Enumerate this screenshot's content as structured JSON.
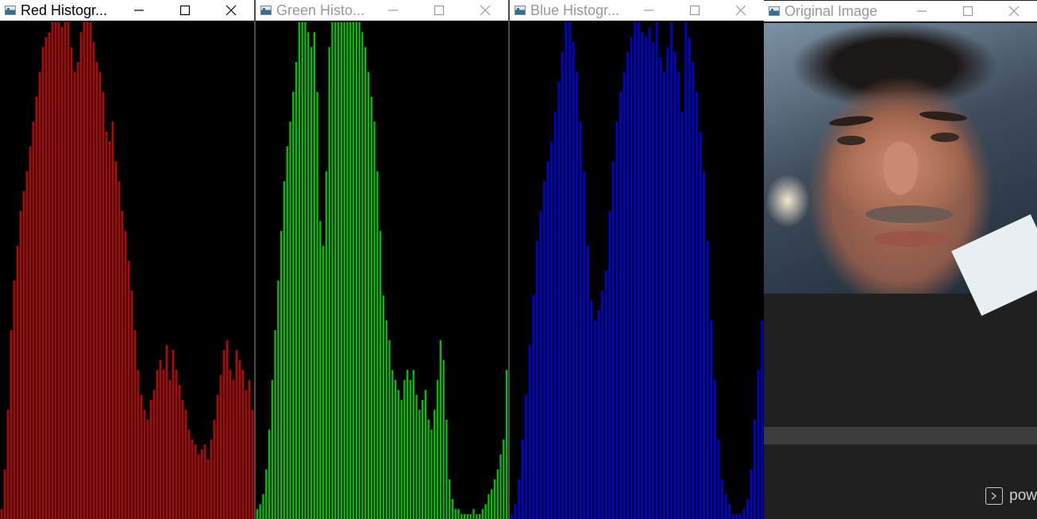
{
  "windows": {
    "red": {
      "title": "Red Histogr...",
      "bar_color": "#c00000"
    },
    "green": {
      "title": "Green Histo...",
      "bar_color": "#00c000"
    },
    "blue": {
      "title": "Blue Histogr...",
      "bar_color": "#0000cc"
    },
    "original": {
      "title": "Original Image"
    }
  },
  "terminal": {
    "label": "pow"
  },
  "icons": {
    "minimize": "minimize-icon",
    "maximize": "maximize-icon",
    "close": "close-icon",
    "terminal": "terminal-icon"
  },
  "histograms": {
    "red": [
      2,
      10,
      22,
      38,
      48,
      55,
      62,
      66,
      70,
      75,
      80,
      85,
      90,
      95,
      97,
      98,
      100,
      100,
      100,
      99,
      100,
      100,
      95,
      90,
      92,
      98,
      100,
      100,
      100,
      96,
      92,
      90,
      86,
      78,
      76,
      80,
      72,
      68,
      62,
      58,
      52,
      46,
      38,
      30,
      25,
      22,
      20,
      24,
      26,
      30,
      32,
      30,
      35,
      28,
      34,
      30,
      27,
      24,
      22,
      18,
      16,
      15,
      13,
      14,
      15,
      12,
      16,
      20,
      25,
      29,
      34,
      36,
      30,
      28,
      34,
      32,
      30,
      26,
      28,
      22
    ],
    "green": [
      2,
      3,
      5,
      10,
      18,
      28,
      38,
      48,
      58,
      68,
      75,
      80,
      86,
      92,
      100,
      100,
      100,
      98,
      95,
      98,
      86,
      60,
      55,
      70,
      95,
      100,
      100,
      100,
      100,
      100,
      100,
      100,
      100,
      100,
      100,
      98,
      95,
      90,
      85,
      80,
      70,
      58,
      45,
      40,
      36,
      30,
      28,
      26,
      24,
      28,
      30,
      28,
      30,
      25,
      22,
      24,
      26,
      20,
      18,
      22,
      28,
      36,
      32,
      20,
      8,
      4,
      2,
      2,
      1,
      1,
      1,
      1,
      2,
      1,
      1,
      2,
      3,
      5,
      6,
      8,
      10,
      13,
      16,
      30
    ],
    "blue": [
      1,
      3,
      8,
      16,
      25,
      35,
      45,
      56,
      62,
      68,
      72,
      76,
      82,
      88,
      94,
      100,
      100,
      96,
      90,
      80,
      70,
      55,
      44,
      40,
      42,
      46,
      50,
      62,
      72,
      80,
      86,
      90,
      94,
      97,
      100,
      100,
      98,
      97,
      99,
      96,
      100,
      93,
      90,
      95,
      100,
      94,
      90,
      82,
      100,
      97,
      92,
      86,
      78,
      70,
      56,
      40,
      28,
      16,
      8,
      5,
      3,
      1,
      1,
      1,
      2,
      4,
      10,
      20,
      30,
      40
    ]
  }
}
